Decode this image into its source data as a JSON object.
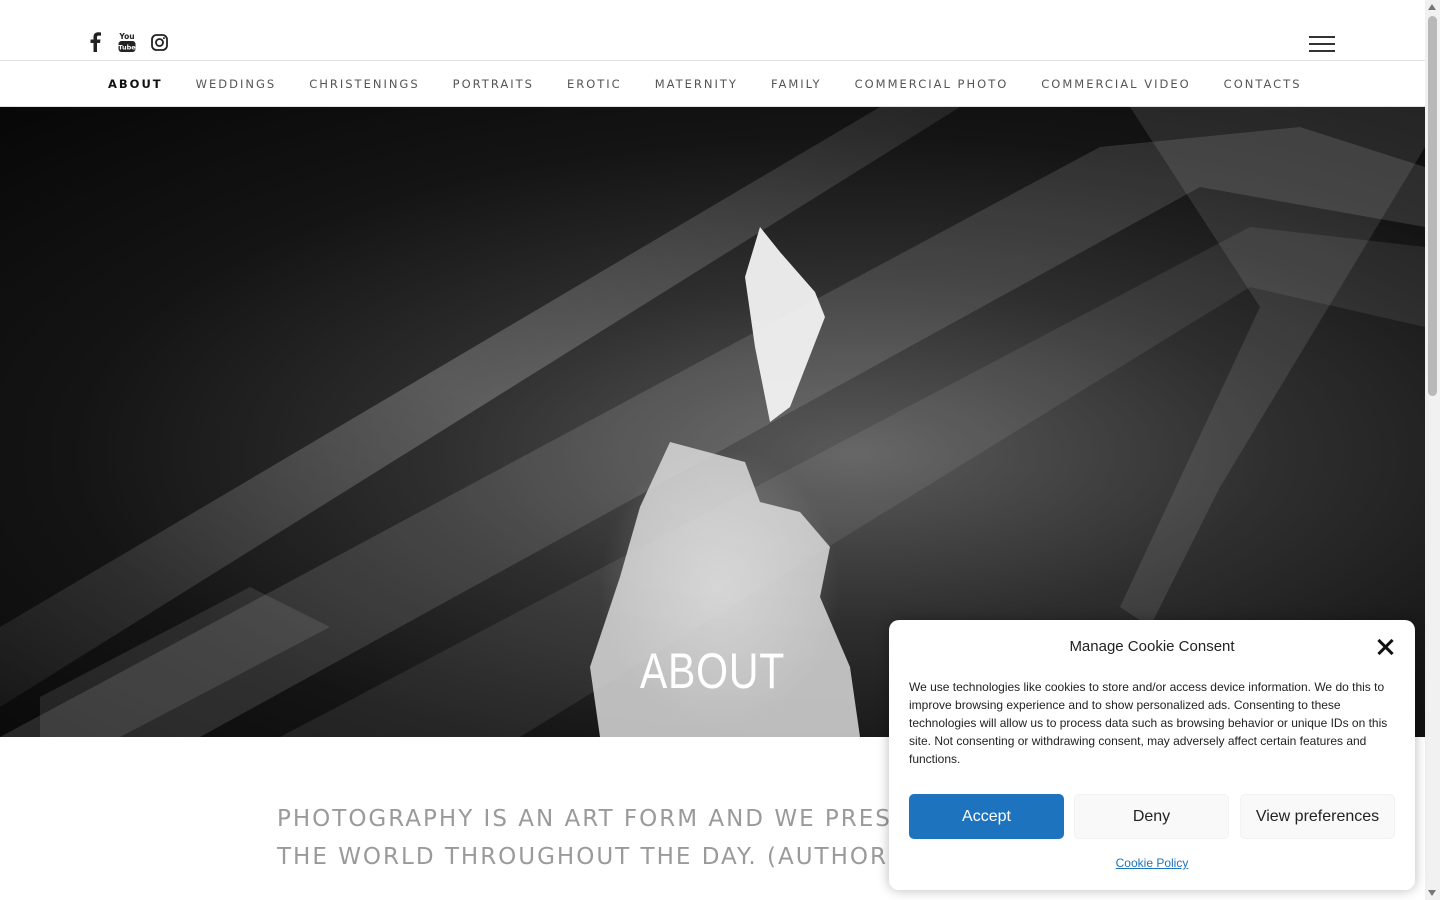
{
  "header": {
    "social_icons": [
      "facebook-icon",
      "youtube-icon",
      "instagram-icon"
    ],
    "youtube_glyph": "You Tube",
    "menu_icon": "hamburger-icon"
  },
  "nav": {
    "items": [
      {
        "label": "ABOUT",
        "active": true
      },
      {
        "label": "WEDDINGS"
      },
      {
        "label": "CHRISTENINGS"
      },
      {
        "label": "PORTRAITS"
      },
      {
        "label": "EROTIC"
      },
      {
        "label": "MATERNITY"
      },
      {
        "label": "FAMILY"
      },
      {
        "label": "COMMERCIAL PHOTO"
      },
      {
        "label": "COMMERCIAL VIDEO"
      },
      {
        "label": "CONTACTS"
      }
    ]
  },
  "hero": {
    "title": "ABOUT"
  },
  "main": {
    "quote_line1": "PHOTOGRAPHY IS AN ART FORM AND WE PRESE",
    "quote_line2": "THE WORLD THROUGHOUT THE DAY. (AUTHOR"
  },
  "cookie": {
    "title": "Manage Cookie Consent",
    "text": "We use technologies like cookies to store and/or access device information. We do this to improve browsing experience and to show personalized ads. Consenting to these technologies will allow us to process data such as browsing behavior or unique IDs on this site. Not consenting or withdrawing consent, may adversely affect certain features and functions.",
    "accept_label": "Accept",
    "deny_label": "Deny",
    "preferences_label": "View preferences",
    "policy_label": "Cookie Policy",
    "accent_color": "#1e73be"
  }
}
